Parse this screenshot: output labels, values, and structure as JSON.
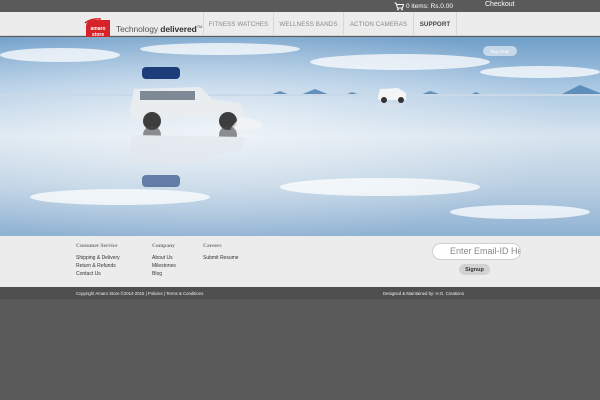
{
  "topbar": {
    "cart_text": "0 items: Rs.0.00",
    "checkout": "Checkout",
    "cart_icon": "shopping-cart-icon"
  },
  "header": {
    "logo_badge_line1": "amaro",
    "logo_badge_line2": "store",
    "tagline_regular": "Technology ",
    "tagline_bold": "delivered",
    "tagline_mark": "TM",
    "nav": [
      {
        "label": "FITNESS WATCHES",
        "width": 71,
        "active": false
      },
      {
        "label": "WELLNESS BANDS",
        "width": 70,
        "active": false
      },
      {
        "label": "ACTION CAMERAS",
        "width": 70,
        "active": false
      },
      {
        "label": "SUPPORT",
        "width": 43,
        "active": true
      }
    ]
  },
  "hero": {
    "buy_now": "Buy Now",
    "image_subject": "jeeps driving across mirrored salt flat"
  },
  "footer": {
    "columns": [
      {
        "heading": "Customer Service",
        "links": [
          "Shipping & Delivery",
          "Return & Refunds",
          "Contact Us"
        ]
      },
      {
        "heading": "Company",
        "links": [
          "About Us",
          "Milestones",
          "Blog"
        ]
      },
      {
        "heading": "Careers",
        "links": [
          "Submit Resume"
        ]
      }
    ],
    "email_placeholder": "Enter Email-ID Here",
    "signup": "Signup"
  },
  "bottom": {
    "copyright": "Copyright Amaro Store ©2014-2015 | Policies | Terms & Conditions",
    "designed": "Designed & Maintained by: H.G. Creations"
  },
  "colors": {
    "brand_red": "#d6232a",
    "header_bg": "#ececec",
    "dark_bg": "#5a5a5a"
  }
}
